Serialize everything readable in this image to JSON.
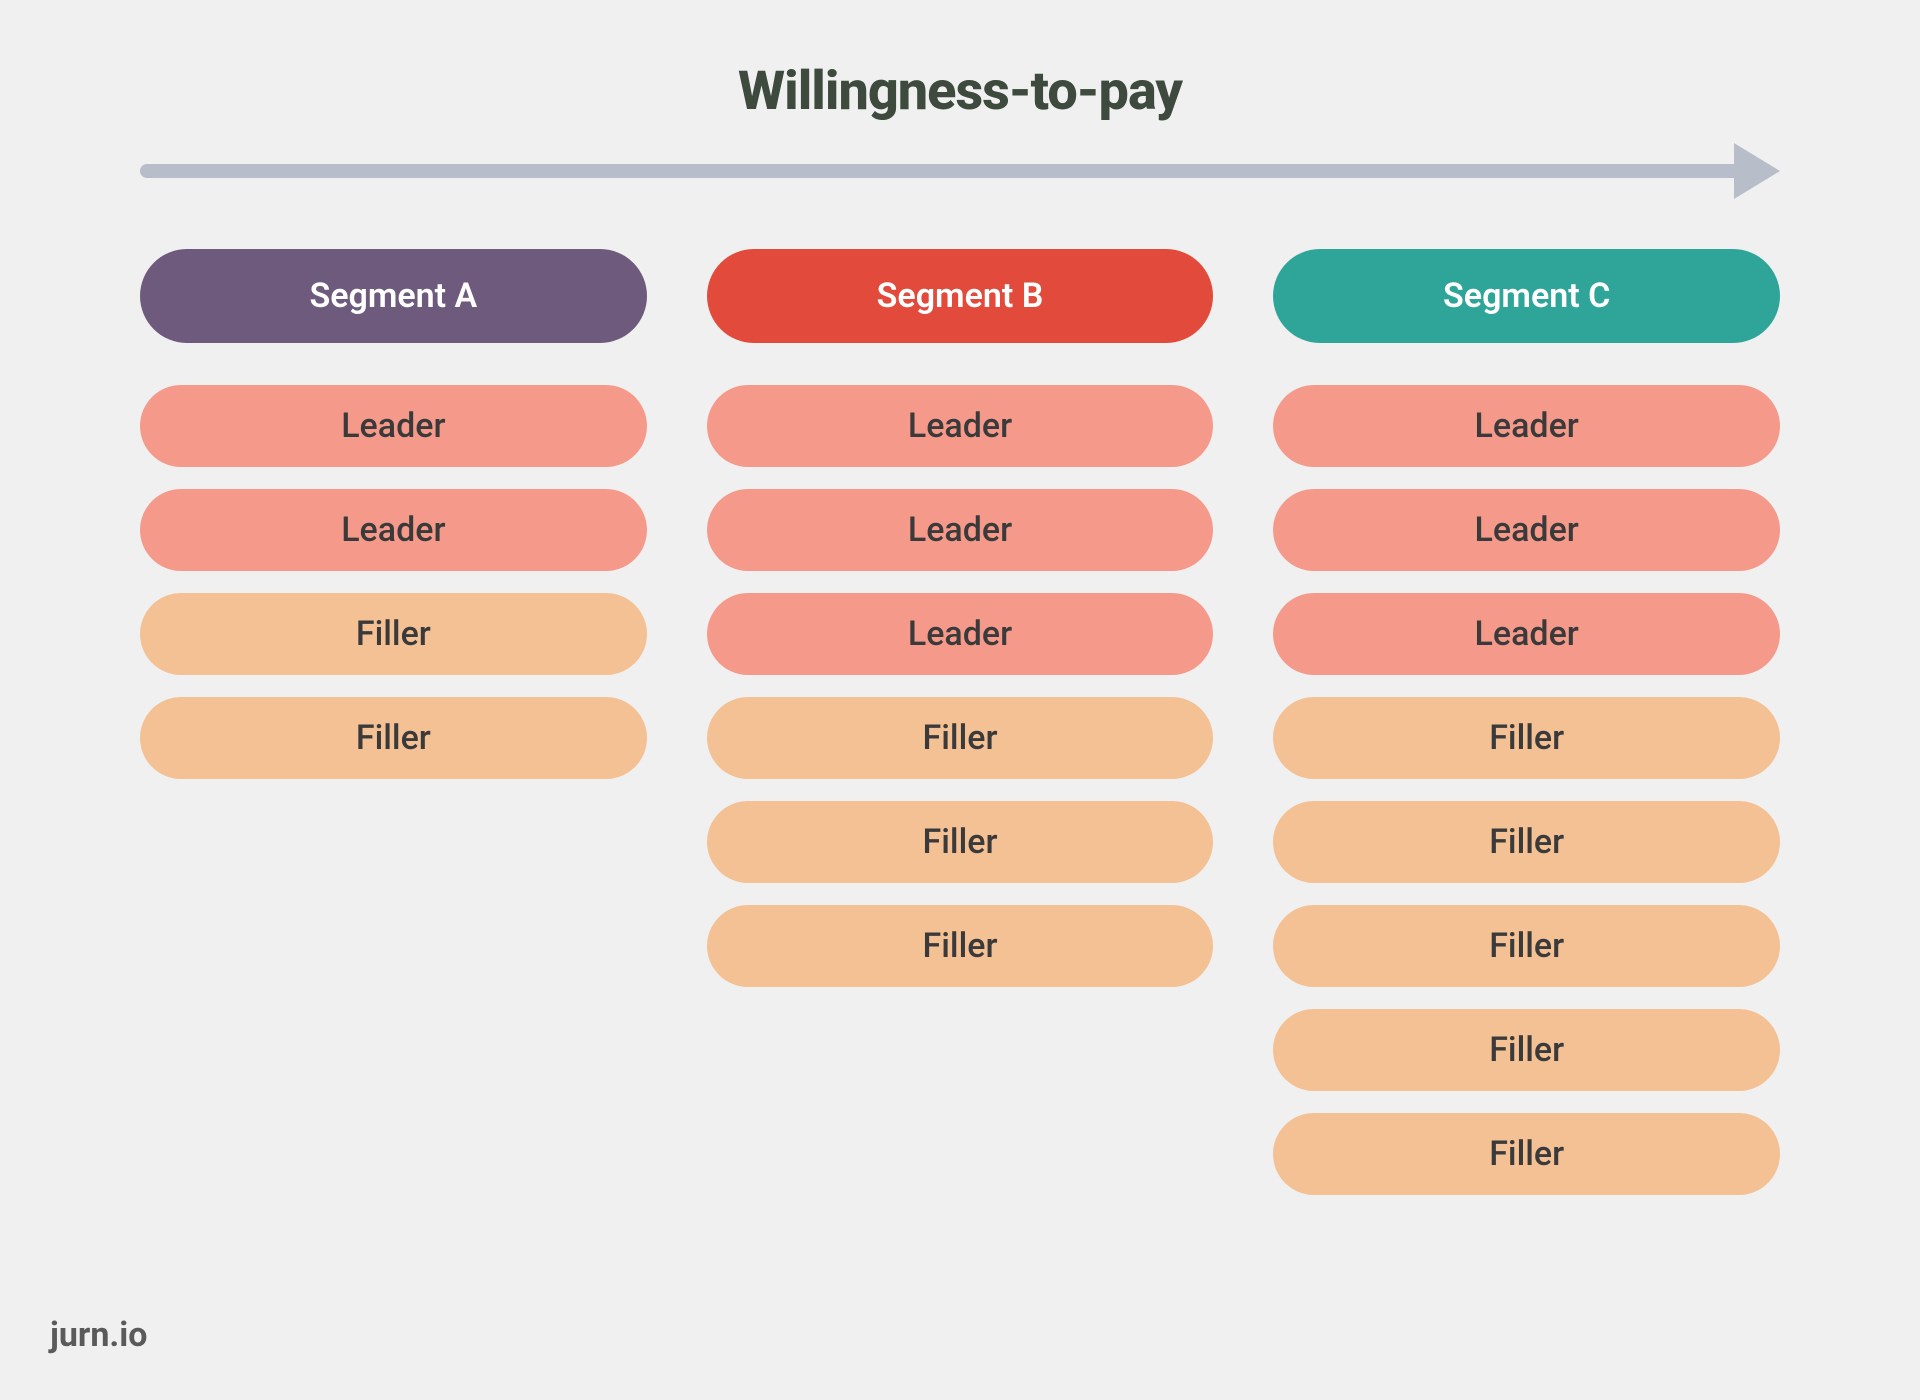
{
  "title": "Willingness-to-pay",
  "footer": "jurn.io",
  "columns": [
    {
      "header": "Segment A",
      "headerClass": "seg-a",
      "items": [
        {
          "label": "Leader",
          "type": "leader"
        },
        {
          "label": "Leader",
          "type": "leader"
        },
        {
          "label": "Filler",
          "type": "filler"
        },
        {
          "label": "Filler",
          "type": "filler"
        }
      ]
    },
    {
      "header": "Segment B",
      "headerClass": "seg-b",
      "items": [
        {
          "label": "Leader",
          "type": "leader"
        },
        {
          "label": "Leader",
          "type": "leader"
        },
        {
          "label": "Leader",
          "type": "leader"
        },
        {
          "label": "Filler",
          "type": "filler"
        },
        {
          "label": "Filler",
          "type": "filler"
        },
        {
          "label": "Filler",
          "type": "filler"
        }
      ]
    },
    {
      "header": "Segment C",
      "headerClass": "seg-c",
      "items": [
        {
          "label": "Leader",
          "type": "leader"
        },
        {
          "label": "Leader",
          "type": "leader"
        },
        {
          "label": "Leader",
          "type": "leader"
        },
        {
          "label": "Filler",
          "type": "filler"
        },
        {
          "label": "Filler",
          "type": "filler"
        },
        {
          "label": "Filler",
          "type": "filler"
        },
        {
          "label": "Filler",
          "type": "filler"
        },
        {
          "label": "Filler",
          "type": "filler"
        }
      ]
    }
  ]
}
